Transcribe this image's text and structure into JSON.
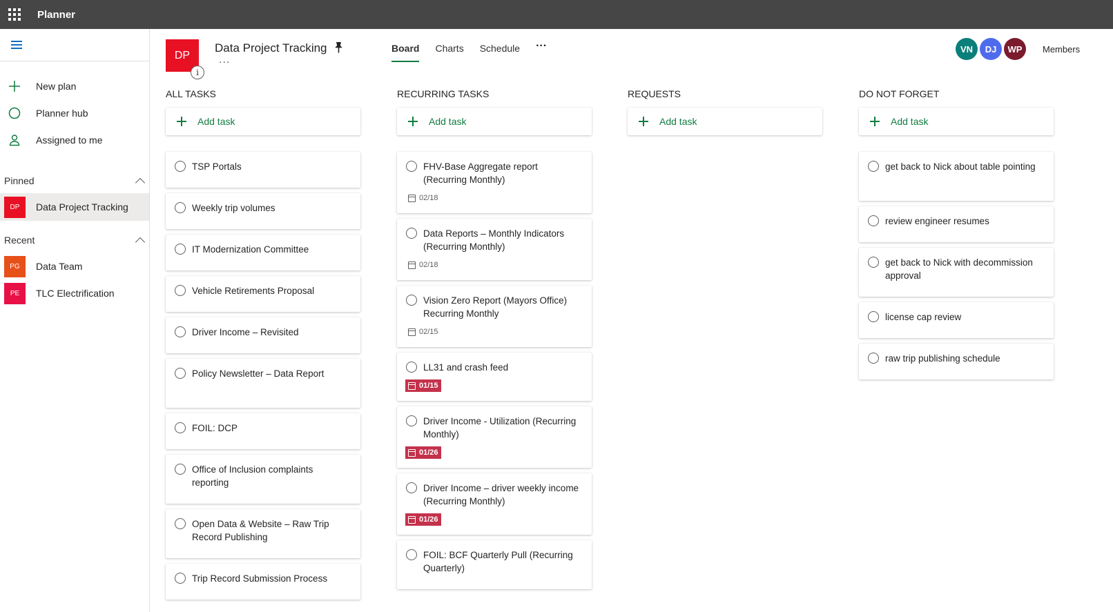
{
  "app": {
    "name": "Planner"
  },
  "nav": {
    "items": [
      {
        "label": "New plan",
        "icon": "plus-icon"
      },
      {
        "label": "Planner hub",
        "icon": "circle-icon"
      },
      {
        "label": "Assigned to me",
        "icon": "person-icon"
      }
    ],
    "pinned_label": "Pinned",
    "pinned": [
      {
        "badge": "DP",
        "label": "Data Project Tracking",
        "color": "#e81123"
      }
    ],
    "recent_label": "Recent",
    "recent": [
      {
        "badge": "PG",
        "label": "Data Team",
        "color": "#e8501a"
      },
      {
        "badge": "PE",
        "label": "TLC Electrification",
        "color": "#e81146"
      }
    ]
  },
  "header": {
    "logo": "DP",
    "info": "i",
    "title": "Data Project Tracking",
    "more": "...",
    "tabs": [
      {
        "label": "Board",
        "active": true
      },
      {
        "label": "Charts",
        "active": false
      },
      {
        "label": "Schedule",
        "active": false
      }
    ],
    "tab_more": "···",
    "avatars": [
      {
        "initials": "VN",
        "color": "#0b7f7a"
      },
      {
        "initials": "DJ",
        "color": "#4f6bed"
      },
      {
        "initials": "WP",
        "color": "#7a1b2e"
      }
    ],
    "members_label": "Members"
  },
  "board": {
    "add_label": "Add task",
    "buckets": [
      {
        "title": "ALL TASKS",
        "tasks": [
          {
            "title": "TSP Portals"
          },
          {
            "title": "Weekly trip volumes"
          },
          {
            "title": "IT Modernization Committee"
          },
          {
            "title": "Vehicle Retirements Proposal"
          },
          {
            "title": "Driver Income – Revisited"
          },
          {
            "title": "Policy Newsletter – Data Report"
          },
          {
            "title": "FOIL: DCP"
          },
          {
            "title": "Office of Inclusion complaints reporting"
          },
          {
            "title": "Open Data & Website – Raw Trip Record Publishing"
          },
          {
            "title": "Trip Record Submission Process"
          }
        ]
      },
      {
        "title": "RECURRING TASKS",
        "tasks": [
          {
            "title": "FHV-Base Aggregate report (Recurring Monthly)",
            "due": "02/18",
            "overdue": false
          },
          {
            "title": "Data Reports – Monthly Indicators (Recurring Monthly)",
            "due": "02/18",
            "overdue": false
          },
          {
            "title": "Vision Zero Report (Mayors Office) Recurring Monthly",
            "due": "02/15",
            "overdue": false
          },
          {
            "title": "LL31 and crash feed",
            "due": "01/15",
            "overdue": true
          },
          {
            "title": "Driver Income - Utilization (Recurring Monthly)",
            "due": "01/26",
            "overdue": true
          },
          {
            "title": "Driver Income – driver weekly income (Recurring Monthly)",
            "due": "01/26",
            "overdue": true
          },
          {
            "title": "FOIL: BCF Quarterly Pull (Recurring Quarterly)"
          }
        ]
      },
      {
        "title": "REQUESTS",
        "tasks": []
      },
      {
        "title": "DO NOT FORGET",
        "tasks": [
          {
            "title": "get back to Nick about table pointing"
          },
          {
            "title": "review engineer resumes"
          },
          {
            "title": "get back to Nick with decommission approval"
          },
          {
            "title": "license cap review"
          },
          {
            "title": "raw trip publishing schedule"
          }
        ]
      }
    ]
  }
}
